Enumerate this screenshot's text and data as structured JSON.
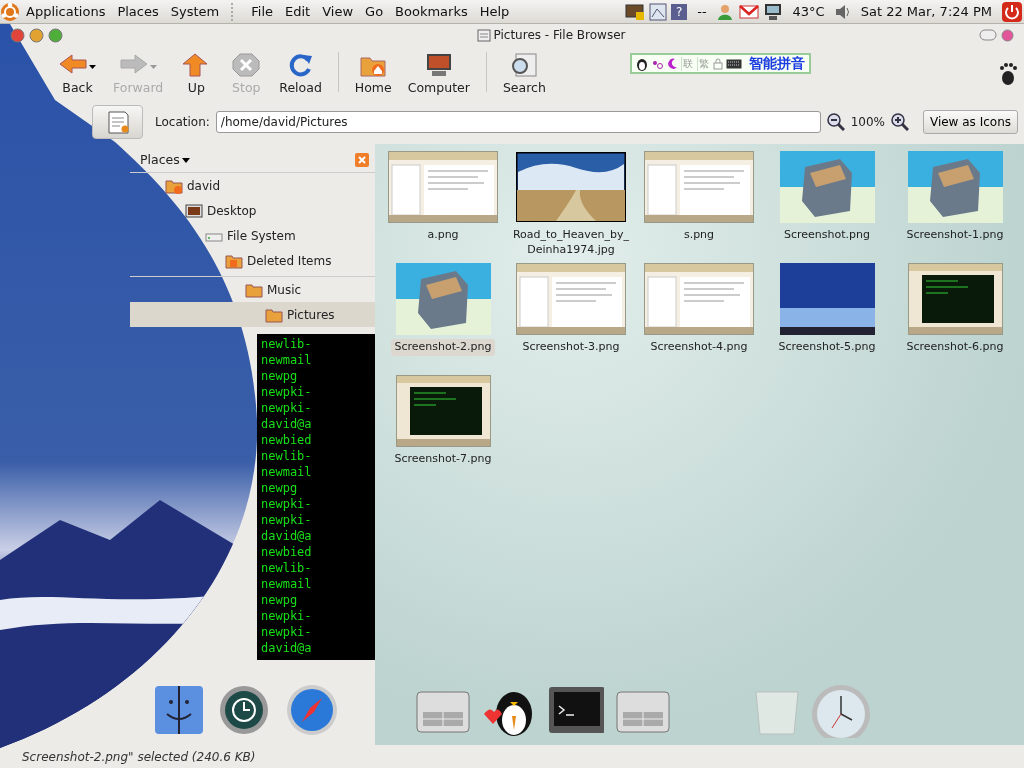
{
  "top_panel": {
    "help_glyph": "?",
    "menus": [
      "Applications",
      "Places",
      "System"
    ],
    "app_menus": [
      "File",
      "Edit",
      "View",
      "Go",
      "Bookmarks",
      "Help"
    ],
    "tray_text": "--",
    "temperature": "43°C",
    "clock": "Sat 22 Mar, 7:24 PM"
  },
  "window": {
    "title": "Pictures - File Browser"
  },
  "toolbar": [
    {
      "label": "Back",
      "kind": "back",
      "disabled": false
    },
    {
      "label": "Forward",
      "kind": "forward",
      "disabled": true
    },
    {
      "label": "Up",
      "kind": "up",
      "disabled": false
    },
    {
      "label": "Stop",
      "kind": "stop",
      "disabled": true
    },
    {
      "label": "Reload",
      "kind": "reload",
      "disabled": false
    },
    {
      "label": "Home",
      "kind": "home",
      "disabled": false
    },
    {
      "label": "Computer",
      "kind": "computer",
      "disabled": false
    },
    {
      "label": "Search",
      "kind": "search",
      "disabled": false
    }
  ],
  "ime_bar": {
    "keys": [
      "联",
      "繁"
    ],
    "mode": "智能拼音"
  },
  "location": {
    "label": "Location:",
    "value": "/home/david/Pictures",
    "zoom": "100%",
    "view": "View as Icons"
  },
  "sidebar": {
    "title": "Places",
    "items": [
      {
        "label": "david",
        "kind": "home",
        "selected": false
      },
      {
        "label": "Desktop",
        "kind": "desktop",
        "selected": false
      },
      {
        "label": "File System",
        "kind": "drive",
        "selected": false
      },
      {
        "label": "Deleted Items",
        "kind": "trash",
        "selected": false
      },
      {
        "label": "Music",
        "kind": "folder",
        "selected": false
      },
      {
        "label": "Pictures",
        "kind": "folder",
        "selected": true
      }
    ]
  },
  "files": [
    {
      "name": "a.png",
      "kind": "window",
      "selected": false
    },
    {
      "name": "Road_to_Heaven_by_Deinha1974.jpg",
      "kind": "landscape",
      "selected": false
    },
    {
      "name": "s.png",
      "kind": "window",
      "selected": false
    },
    {
      "name": "Screenshot.png",
      "kind": "cube",
      "selected": false
    },
    {
      "name": "Screenshot-1.png",
      "kind": "cube",
      "selected": false
    },
    {
      "name": "Screenshot-2.png",
      "kind": "cube",
      "selected": true
    },
    {
      "name": "Screenshot-3.png",
      "kind": "window",
      "selected": false
    },
    {
      "name": "Screenshot-4.png",
      "kind": "window",
      "selected": false
    },
    {
      "name": "Screenshot-5.png",
      "kind": "blue",
      "selected": false
    },
    {
      "name": "Screenshot-6.png",
      "kind": "terminal",
      "selected": false
    },
    {
      "name": "Screenshot-7.png",
      "kind": "terminal",
      "selected": false
    }
  ],
  "terminal": {
    "lines": [
      "newlib-",
      "newmail",
      "newpg",
      "newpki-",
      "newpki-",
      "david@a",
      "newbied",
      "newlib-",
      "newmail",
      "newpg",
      "newpki-",
      "newpki-",
      "david@a",
      "newbied",
      "newlib-",
      "newmail",
      "newpg",
      "newpki-",
      "newpki-",
      "david@a"
    ]
  },
  "status_bar": "Screenshot-2.png\" selected (240.6 KB)"
}
